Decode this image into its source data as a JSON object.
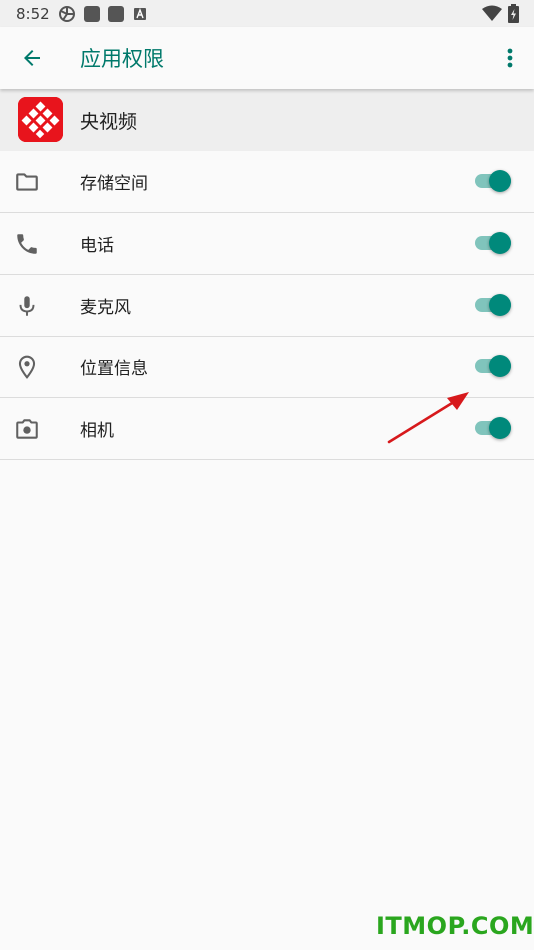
{
  "status_bar": {
    "time": "8:52",
    "notification_icons": [
      "cast-icon",
      "square-icon",
      "square-icon",
      "a-box-icon"
    ],
    "system_icons": [
      "wifi-icon",
      "battery-charging-icon"
    ]
  },
  "app_bar": {
    "title": "应用权限",
    "back_icon": "arrow-left-icon",
    "menu_icon": "more-vertical-icon",
    "accent_color": "#00796b"
  },
  "app": {
    "name": "央视频",
    "icon_color": "#e8141c"
  },
  "permissions": [
    {
      "label": "存储空间",
      "icon": "folder-icon",
      "enabled": true
    },
    {
      "label": "电话",
      "icon": "phone-icon",
      "enabled": true
    },
    {
      "label": "麦克风",
      "icon": "microphone-icon",
      "enabled": true
    },
    {
      "label": "位置信息",
      "icon": "location-pin-icon",
      "enabled": true
    },
    {
      "label": "相机",
      "icon": "camera-icon",
      "enabled": true
    }
  ],
  "colors": {
    "switch_on": "#00897b",
    "switch_track": "#80c4bc",
    "annotation_arrow": "#d7191c"
  },
  "watermark": "ITMOP.COM"
}
